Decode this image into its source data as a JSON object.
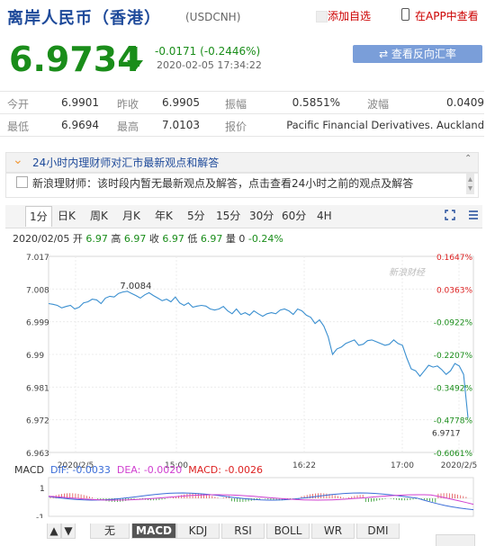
{
  "header": {
    "title": "离岸人民币（香港）",
    "code": "(USDCNH)",
    "watch_label": "添加自选",
    "app_label": "在APP中查看"
  },
  "quote": {
    "price": "6.9734",
    "change": "-0.0171 (-0.2446%)",
    "time": "2020-02-05  17:34:22",
    "direction": "down",
    "color": "#1a8d1a"
  },
  "reverse_button": "⇄ 查看反向汇率",
  "stats": [
    {
      "label": "今开",
      "value": "6.9901"
    },
    {
      "label": "昨收",
      "value": "6.9905"
    },
    {
      "label": "振幅",
      "value": "0.5851%"
    },
    {
      "label": "波幅",
      "value": "0.0409"
    },
    {
      "label": "最低",
      "value": "6.9694"
    },
    {
      "label": "最高",
      "value": "7.0103"
    },
    {
      "label": "报价",
      "value": "Pacific Financial Derivatives. Auckland"
    }
  ],
  "notice": {
    "title": "24小时内理财师对汇市最新观点和解答",
    "text": "新浪理财师：该时段内暂无最新观点及解答，点击查看24小时之前的观点及解答"
  },
  "tabs": [
    "1分",
    "日K",
    "周K",
    "月K",
    "年K",
    "5分",
    "15分",
    "30分",
    "60分",
    "4H"
  ],
  "active_tab": "1分",
  "info_bar": {
    "date": "2020/02/05",
    "open_label": "开",
    "open": "6.97",
    "high_label": "高",
    "high": "6.97",
    "close_label": "收",
    "close": "6.97",
    "low_label": "低",
    "low": "6.97",
    "vol_label": "量",
    "vol": "0",
    "pct": "-0.24%"
  },
  "chart_data": {
    "type": "line",
    "watermark": "新浪财经",
    "y_ticks": [
      "7.017",
      "7.008",
      "6.999",
      "6.99",
      "6.981",
      "6.972",
      "6.963"
    ],
    "right_ticks": [
      {
        "text": "0.1647%",
        "color": "#d22"
      },
      {
        "text": "0.0363%",
        "color": "#d22"
      },
      {
        "text": "-0.0922%",
        "color": "#1a8d1a"
      },
      {
        "text": "-0.2207%",
        "color": "#1a8d1a"
      },
      {
        "text": "-0.3492%",
        "color": "#1a8d1a"
      },
      {
        "text": "-0.4778%",
        "color": "#1a8d1a"
      },
      {
        "text": "-0.6061%",
        "color": "#1a8d1a"
      }
    ],
    "x_ticks": [
      "2020/2/5",
      "15:00",
      "16:22",
      "17:00",
      "2020/2/5"
    ],
    "ylim": [
      6.963,
      7.017
    ],
    "max_label": "7.0084",
    "last_label": "6.9717",
    "values": [
      7.004,
      7.0038,
      7.0035,
      7.0028,
      7.0032,
      7.0035,
      7.0025,
      7.003,
      7.0042,
      7.0045,
      7.0052,
      7.005,
      7.004,
      7.0055,
      7.006,
      7.0058,
      7.0068,
      7.0072,
      7.0074,
      7.0068,
      7.0062,
      7.0055,
      7.0064,
      7.007,
      7.0062,
      7.0055,
      7.0048,
      7.0052,
      7.0045,
      7.0058,
      7.0042,
      7.0035,
      7.0042,
      7.003,
      7.0033,
      7.0035,
      7.0033,
      7.0025,
      7.0022,
      7.0025,
      7.0032,
      7.002,
      7.0012,
      7.0025,
      7.001,
      7.0015,
      7.0008,
      7.002,
      7.0012,
      7.0005,
      7.0012,
      7.0015,
      7.0012,
      7.0022,
      7.0025,
      7.002,
      7.001,
      7.0025,
      7.002,
      7.0008,
      7.0002,
      6.9985,
      6.9995,
      6.9978,
      6.9948,
      6.99,
      6.9915,
      6.992,
      6.993,
      6.9935,
      6.994,
      6.9925,
      6.9928,
      6.9938,
      6.994,
      6.9935,
      6.993,
      6.9925,
      6.9928,
      6.994,
      6.993,
      6.9925,
      6.989,
      6.986,
      6.9855,
      6.984,
      6.9855,
      6.987,
      6.9865,
      6.9868,
      6.9858,
      6.9845,
      6.9855,
      6.9875,
      6.9868,
      6.9845,
      6.9725
    ]
  },
  "macd": {
    "label": "MACD",
    "dif_label": "DIF:",
    "dif": "-0.0033",
    "dea_label": "DEA:",
    "dea": "-0.0020",
    "macd_label": "MACD:",
    "macd_val": "-0.0026",
    "tick_top": "1",
    "tick_bot": "-1"
  },
  "bottom_tabs": [
    "▲",
    "▼",
    "无",
    "MACD",
    "KDJ",
    "RSI",
    "BOLL",
    "WR",
    "DMI"
  ],
  "bottom_active": "MACD"
}
